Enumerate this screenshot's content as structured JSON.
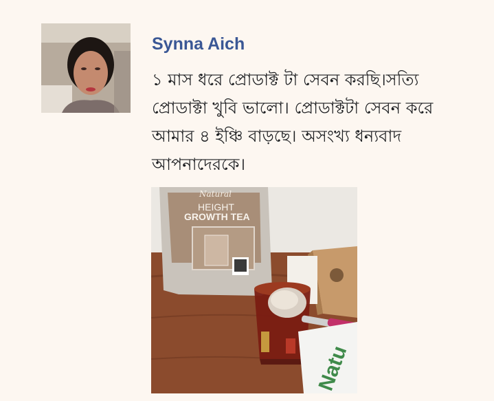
{
  "review": {
    "author_name": "Synna Aich",
    "comment_lines": [
      "১ মাস ধরে প্রোডাক্ট টা সেবন করছি।সত্যি",
      "প্রোডাক্টা খুবি ভালো। প্রোডাক্টটা সেবন করে",
      "আমার ৪ ইঞ্চি বাড়ছে। অসংখ্য ধন্যবাদ",
      "আপনাদেরকে।"
    ]
  },
  "photo": {
    "package_brand": "Natural",
    "package_title_line1": "HEIGHT",
    "package_title_line2": "GROWTH TEA",
    "box_brand": "Natu"
  }
}
